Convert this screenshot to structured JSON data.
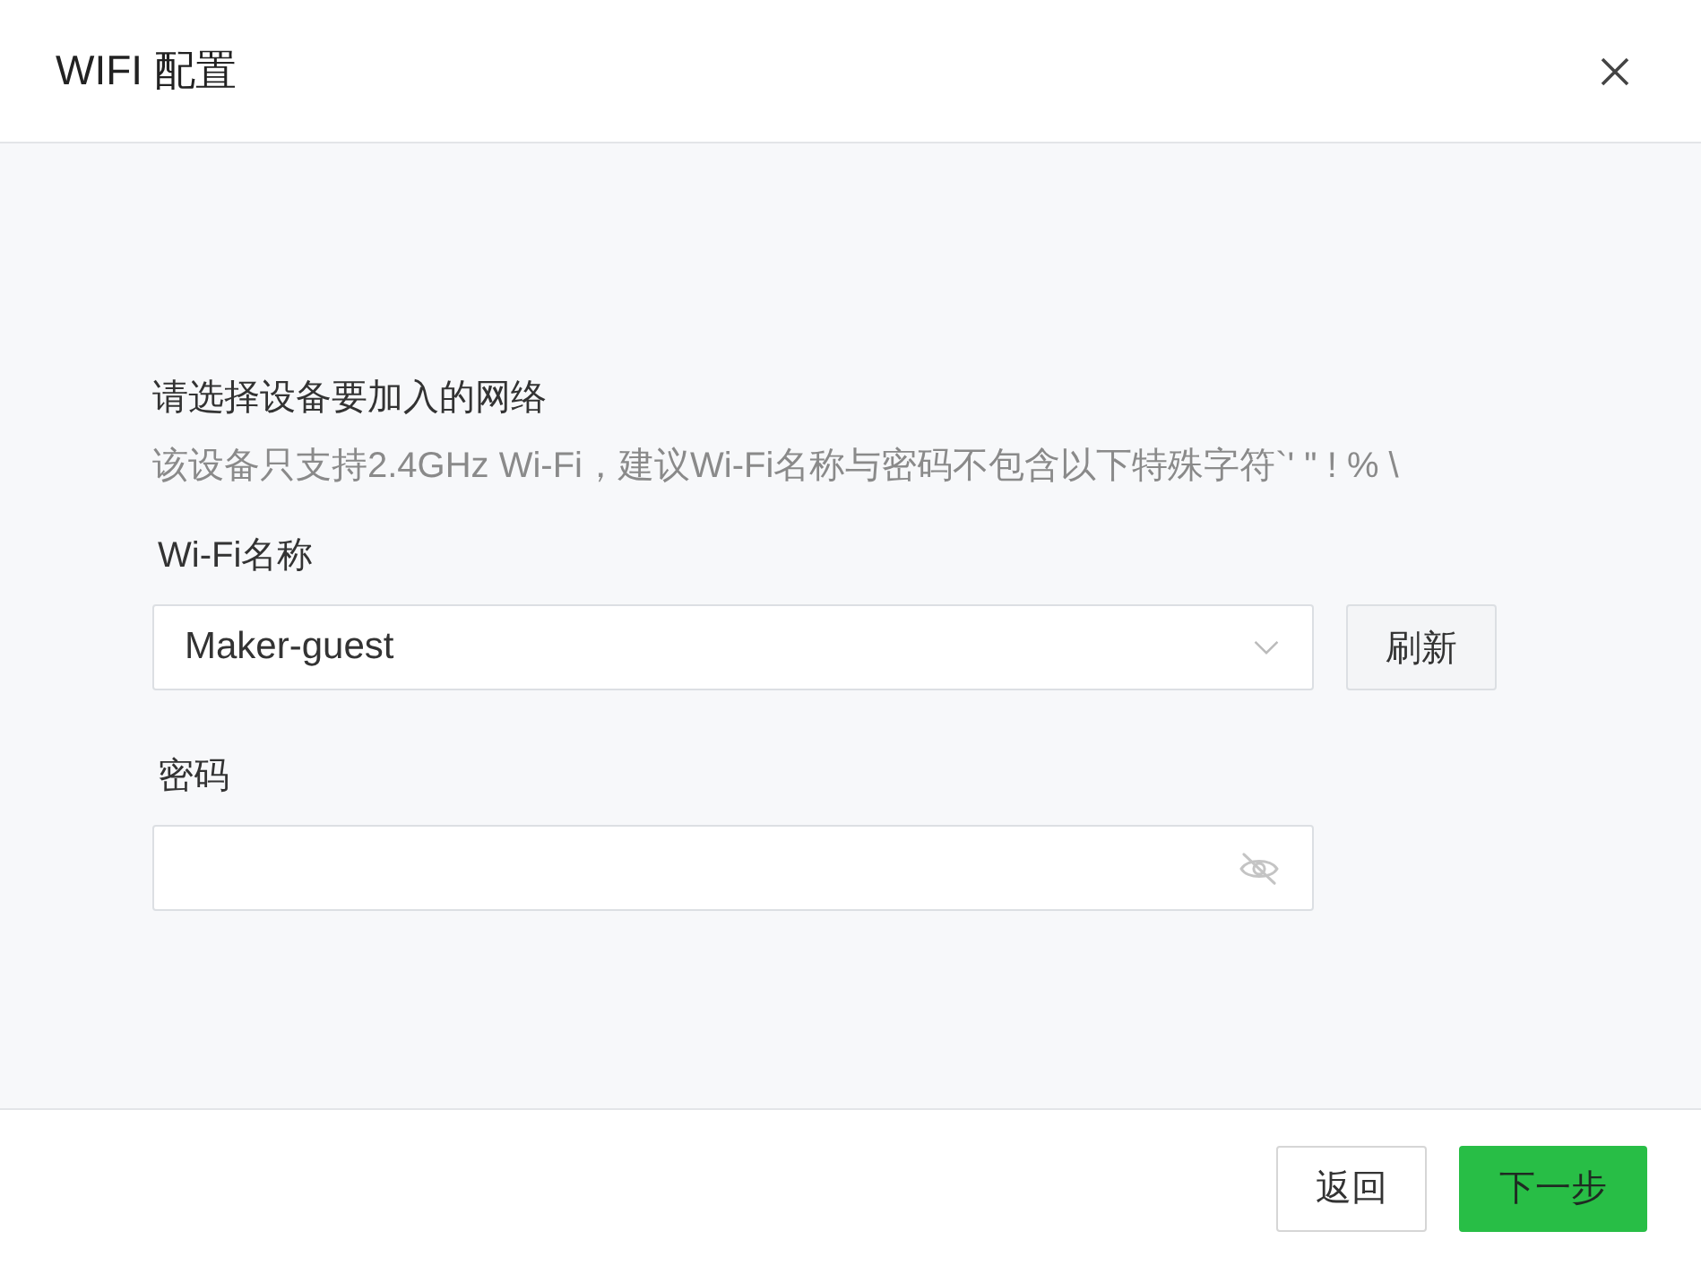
{
  "dialog": {
    "title": "WIFI 配置"
  },
  "intro": {
    "heading": "请选择设备要加入的网络",
    "hint": "该设备只支持2.4GHz Wi-Fi，建议Wi-Fi名称与密码不包含以下特殊字符`' \" ! % \\"
  },
  "fields": [
    {
      "kind": "select",
      "label": "Wi-Fi名称",
      "value": "Maker-guest",
      "button": "刷新"
    },
    {
      "kind": "password",
      "label": "密码"
    }
  ],
  "footer": {
    "buttons": [
      {
        "label": "返回",
        "kind": "secondary"
      },
      {
        "label": "下一步",
        "kind": "primary"
      }
    ]
  }
}
